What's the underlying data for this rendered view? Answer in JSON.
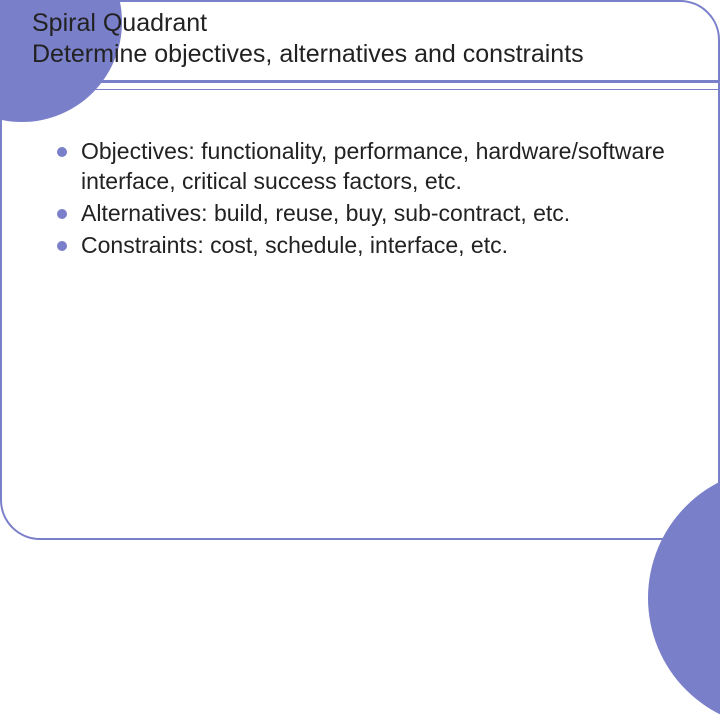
{
  "title": {
    "line1": "Spiral Quadrant",
    "line2": "Determine objectives, alternatives and constraints"
  },
  "bullets": [
    "Objectives:  functionality, performance, hardware/software interface, critical success factors, etc.",
    "Alternatives: build, reuse, buy, sub-contract, etc.",
    "Constraints:  cost, schedule, interface, etc."
  ]
}
